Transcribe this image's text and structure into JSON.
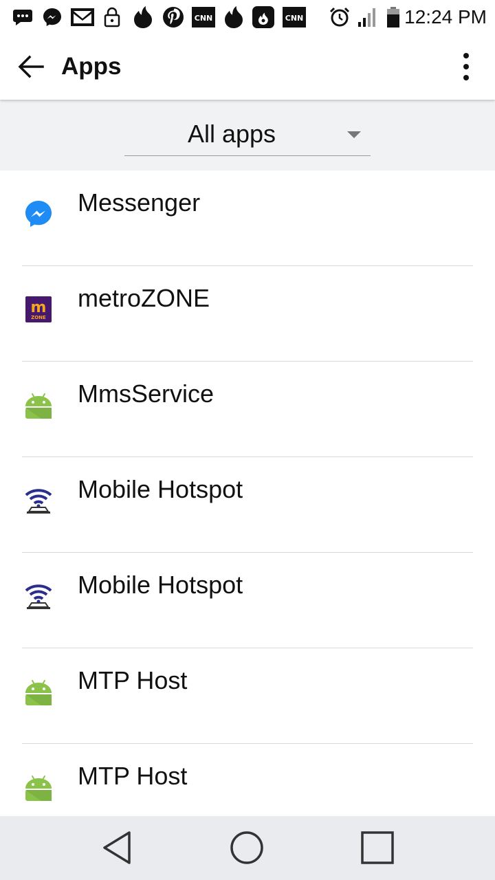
{
  "status_bar": {
    "time": "12:24 PM",
    "icons": [
      "sms-icon",
      "messenger-icon",
      "gmail-icon",
      "lock-icon",
      "tinder-icon",
      "pinterest-icon",
      "cnn-icon",
      "tinder-icon",
      "hotspot-flame-icon",
      "cnn-icon",
      "alarm-icon",
      "signal-icon",
      "battery-icon"
    ],
    "cnn_text": "CNN"
  },
  "app_bar": {
    "title": "Apps"
  },
  "filter": {
    "selected": "All apps"
  },
  "apps": [
    {
      "name": "Messenger",
      "icon": "messenger-icon"
    },
    {
      "name": "metroZONE",
      "icon": "metrozone-icon"
    },
    {
      "name": "MmsService",
      "icon": "android-icon"
    },
    {
      "name": "Mobile Hotspot",
      "icon": "hotspot-icon"
    },
    {
      "name": "Mobile Hotspot",
      "icon": "hotspot-icon"
    },
    {
      "name": "MTP Host",
      "icon": "android-icon"
    },
    {
      "name": "MTP Host",
      "icon": "android-icon"
    }
  ],
  "metrozone_logo": {
    "letter": "m",
    "word": "ZONE"
  },
  "colors": {
    "messenger_blue": "#1e8cf4",
    "metrozone_purple": "#46196e",
    "metrozone_orange": "#f5a623",
    "android_green": "#8bc34a",
    "hotspot_navy": "#2b2e8c",
    "filter_bg": "#f1f2f4",
    "nav_bg": "#eaebef"
  },
  "nav_bar": {
    "buttons": [
      "back-nav-icon",
      "home-nav-icon",
      "recents-nav-icon"
    ]
  }
}
